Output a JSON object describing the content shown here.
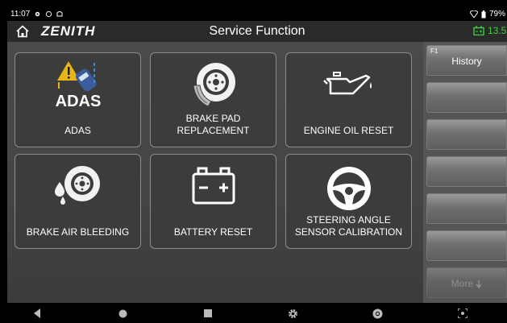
{
  "status_bar": {
    "time": "11:07",
    "battery_percent": "79%"
  },
  "header": {
    "brand": "ZENITH",
    "title": "Service Function",
    "voltage": "13.5"
  },
  "tiles": [
    {
      "id": "adas",
      "label": "ADAS",
      "icon": "adas-icon",
      "icon_text": "ADAS"
    },
    {
      "id": "brake-pad",
      "label": "BRAKE PAD\nREPLACEMENT",
      "icon": "brake-pad-icon"
    },
    {
      "id": "engine-oil",
      "label": "ENGINE OIL RESET",
      "icon": "oil-can-icon"
    },
    {
      "id": "brake-air",
      "label": "BRAKE AIR BLEEDING",
      "icon": "brake-fluid-icon"
    },
    {
      "id": "battery",
      "label": "BATTERY RESET",
      "icon": "battery-icon"
    },
    {
      "id": "steering",
      "label": "STEERING ANGLE\nSENSOR CALIBRATION",
      "icon": "steering-wheel-icon"
    }
  ],
  "side_panel": {
    "history": {
      "fkey": "F1",
      "label": "History"
    },
    "more": {
      "label": "More"
    }
  },
  "colors": {
    "accent_green": "#3dd13d",
    "header_bg": "#2a2a2a",
    "tile_bg": "#3c3c3c"
  }
}
